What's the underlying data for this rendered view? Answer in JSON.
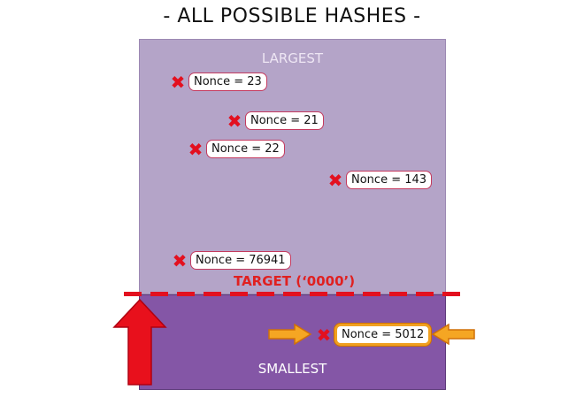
{
  "title": "- ALL POSSIBLE HASHES -",
  "regions": {
    "largest_label": "LARGEST",
    "smallest_label": "SMALLEST",
    "target_label": "TARGET (‘0000’)"
  },
  "nonces": [
    {
      "label": "Nonce = 23",
      "accepted": false
    },
    {
      "label": "Nonce = 21",
      "accepted": false
    },
    {
      "label": "Nonce = 22",
      "accepted": false
    },
    {
      "label": "Nonce = 143",
      "accepted": false
    },
    {
      "label": "Nonce = 76941",
      "accepted": false
    },
    {
      "label": "Nonce = 5012",
      "accepted": true
    }
  ],
  "colors": {
    "upper_region": "#b4a4c8",
    "lower_region": "#8456a6",
    "target_line": "#e3101f",
    "x_mark": "#e3101f",
    "highlight_arrow": "#f5a623",
    "up_arrow": "#e8101c"
  },
  "icons": {
    "reject": "x-mark-icon",
    "pointer": "arrow-icon",
    "up": "up-arrow-icon"
  }
}
